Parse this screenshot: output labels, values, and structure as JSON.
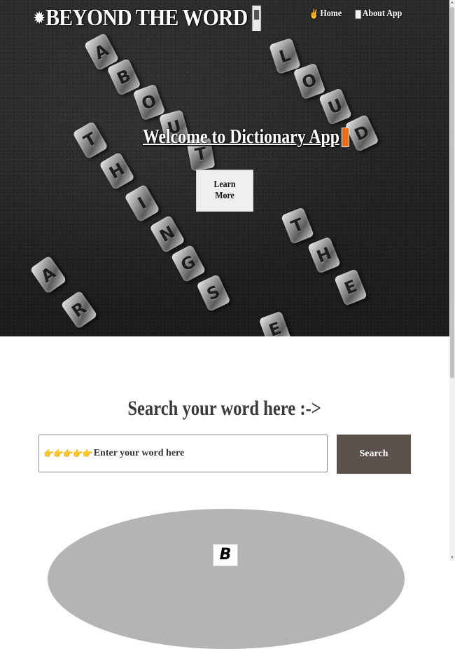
{
  "header": {
    "brand_title": "BEYOND THE WORD",
    "brand_icons": [
      "burst-icon",
      "phone-icon"
    ],
    "nav": [
      {
        "label": "Home",
        "icon": "hand-pointer-icon"
      },
      {
        "label": "About App",
        "icon": "book-icon"
      }
    ]
  },
  "hero": {
    "welcome": "Welcome to Dictionary App",
    "welcome_icon": "orange-book-icon",
    "learn_more": "Learn More",
    "background_letters": [
      "A",
      "B",
      "O",
      "U",
      "T",
      "L",
      "O",
      "U",
      "D",
      "T",
      "H",
      "I",
      "N",
      "G",
      "S",
      "T",
      "H",
      "E",
      "A",
      "R",
      "E"
    ]
  },
  "search": {
    "title": "Search your word here :->",
    "hands": "👉👉👉👉👉",
    "placeholder": "Enter your word here",
    "value": "",
    "button_label": "Search"
  },
  "footer_preview": {
    "icon_text": "B"
  },
  "colors": {
    "search_button": "#5b524d",
    "ellipse": "#b4b4b4",
    "accent_orange": "#ec6a12"
  }
}
